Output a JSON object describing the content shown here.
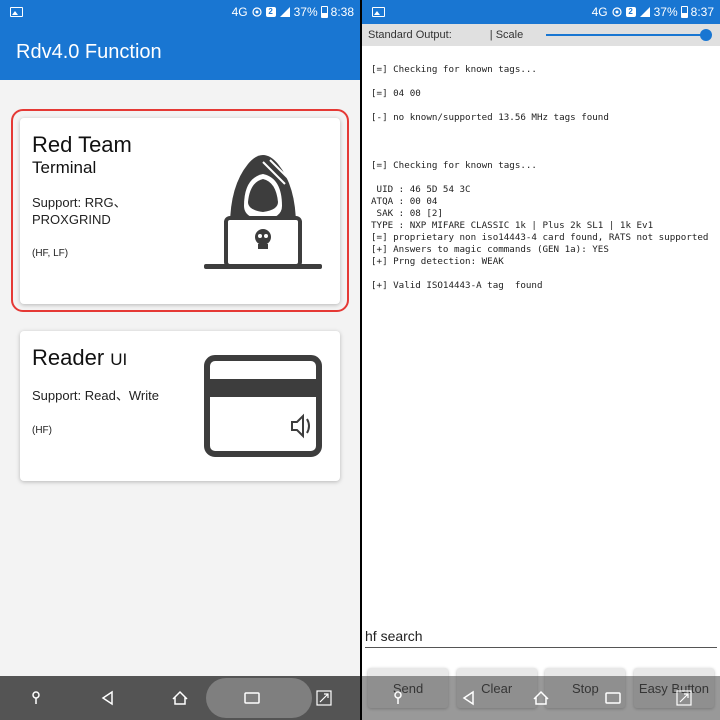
{
  "left": {
    "statusbar": {
      "network": "4G",
      "battery": "37%",
      "time": "8:38"
    },
    "title": "Rdv4.0 Function",
    "cards": [
      {
        "title": "Red Team",
        "subtitle": "Terminal",
        "support_line1": "Support: RRG、",
        "support_line2": "PROXGRIND",
        "freq": "(HF, LF)"
      },
      {
        "title": "Reader",
        "title_suffix": "UI",
        "support_line1": "Support: Read、Write",
        "freq": "(HF)"
      }
    ]
  },
  "right": {
    "statusbar": {
      "network": "4G",
      "battery": "37%",
      "time": "8:37"
    },
    "toolbar": {
      "output_label": "Standard Output:",
      "scale_label": "| Scale",
      "scale_value": 1.0
    },
    "console_lines": [
      "[=] Checking for known tags...",
      "",
      "[=] 04 00",
      "",
      "[-] no known/supported 13.56 MHz tags found",
      "",
      "",
      "",
      "[=] Checking for known tags...",
      "",
      " UID : 46 5D 54 3C",
      "ATQA : 00 04",
      " SAK : 08 [2]",
      "TYPE : NXP MIFARE CLASSIC 1k | Plus 2k SL1 | 1k Ev1",
      "[=] proprietary non iso14443-4 card found, RATS not supported",
      "[+] Answers to magic commands (GEN 1a): YES",
      "[+] Prng detection: WEAK",
      "",
      "[+] Valid ISO14443-A tag  found"
    ],
    "command_input": "hf search",
    "buttons": [
      "Send",
      "Clear",
      "Stop",
      "Easy Button"
    ]
  },
  "colors": {
    "primary": "#1976d2",
    "selection": "#e53935",
    "icon": "#3d3d3d"
  }
}
